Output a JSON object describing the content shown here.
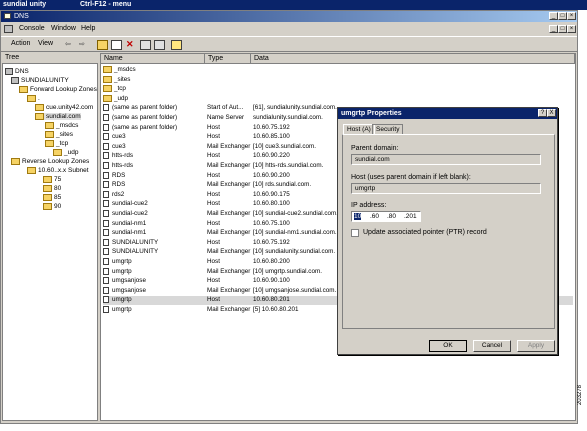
{
  "outer_window": {
    "title_left": "sundial unity",
    "title_right": "Ctrl-F12 - menu"
  },
  "mmc": {
    "title": "DNS",
    "menu": [
      "Console",
      "Window",
      "Help"
    ],
    "action_menu": [
      "Action",
      "View"
    ]
  },
  "tree": {
    "tab_label": "Tree",
    "nodes": [
      {
        "label": "DNS",
        "depth": 0
      },
      {
        "label": "SUNDIALUNITY",
        "depth": 1
      },
      {
        "label": "Forward Lookup Zones",
        "depth": 2
      },
      {
        "label": ".",
        "depth": 3
      },
      {
        "label": "cue.unity42.com",
        "depth": 3
      },
      {
        "label": "sundial.com",
        "depth": 3
      },
      {
        "label": "_msdcs",
        "depth": 4
      },
      {
        "label": "_sites",
        "depth": 4
      },
      {
        "label": "_tcp",
        "depth": 4
      },
      {
        "label": "_udp",
        "depth": 4
      },
      {
        "label": "Reverse Lookup Zones",
        "depth": 2
      },
      {
        "label": "10.60..x.x Subnet",
        "depth": 3
      },
      {
        "label": "75",
        "depth": 4
      },
      {
        "label": "80",
        "depth": 4
      },
      {
        "label": "85",
        "depth": 4
      },
      {
        "label": "90",
        "depth": 4
      }
    ]
  },
  "list": {
    "columns": [
      "Name",
      "Type",
      "Data"
    ],
    "rows": [
      {
        "name": "_msdcs",
        "type": "",
        "data": "",
        "kind": "folder"
      },
      {
        "name": "_sites",
        "type": "",
        "data": "",
        "kind": "folder"
      },
      {
        "name": "_tcp",
        "type": "",
        "data": "",
        "kind": "folder"
      },
      {
        "name": "_udp",
        "type": "",
        "data": "",
        "kind": "folder"
      },
      {
        "name": "(same as parent folder)",
        "type": "Start of Aut...",
        "data": "[61], sundialunity.sundial.com.",
        "kind": "rec"
      },
      {
        "name": "(same as parent folder)",
        "type": "Name Server",
        "data": "sundialunity.sundial.com.",
        "kind": "rec"
      },
      {
        "name": "(same as parent folder)",
        "type": "Host",
        "data": "10.60.75.192",
        "kind": "rec"
      },
      {
        "name": "cue3",
        "type": "Host",
        "data": "10.60.85.100",
        "kind": "rec"
      },
      {
        "name": "cue3",
        "type": "Mail Exchanger",
        "data": "[10] cue3.sundial.com.",
        "kind": "rec"
      },
      {
        "name": "htts-rds",
        "type": "Host",
        "data": "10.60.90.220",
        "kind": "rec"
      },
      {
        "name": "htts-rds",
        "type": "Mail Exchanger",
        "data": "[10] htts-rds.sundial.com.",
        "kind": "rec"
      },
      {
        "name": "RDS",
        "type": "Host",
        "data": "10.60.90.200",
        "kind": "rec"
      },
      {
        "name": "RDS",
        "type": "Mail Exchanger",
        "data": "[10] rds.sundial.com.",
        "kind": "rec"
      },
      {
        "name": "rds2",
        "type": "Host",
        "data": "10.60.90.175",
        "kind": "rec"
      },
      {
        "name": "sundial-cue2",
        "type": "Host",
        "data": "10.60.80.100",
        "kind": "rec"
      },
      {
        "name": "sundial-cue2",
        "type": "Mail Exchanger",
        "data": "[10] sundial-cue2.sundial.com.",
        "kind": "rec"
      },
      {
        "name": "sundial-nm1",
        "type": "Host",
        "data": "10.60.75.100",
        "kind": "rec"
      },
      {
        "name": "sundial-nm1",
        "type": "Mail Exchanger",
        "data": "[10] sundial-nm1.sundial.com.",
        "kind": "rec"
      },
      {
        "name": "SUNDIALUNITY",
        "type": "Host",
        "data": "10.60.75.192",
        "kind": "rec"
      },
      {
        "name": "SUNDIALUNITY",
        "type": "Mail Exchanger",
        "data": "[10] sundialunity.sundial.com.",
        "kind": "rec"
      },
      {
        "name": "umgrtp",
        "type": "Host",
        "data": "10.60.80.200",
        "kind": "rec"
      },
      {
        "name": "umgrtp",
        "type": "Mail Exchanger",
        "data": "[10] umgrtp.sundial.com.",
        "kind": "rec"
      },
      {
        "name": "umgsanjose",
        "type": "Host",
        "data": "10.60.90.100",
        "kind": "rec"
      },
      {
        "name": "umgsanjose",
        "type": "Mail Exchanger",
        "data": "[10] umgsanjose.sundial.com.",
        "kind": "rec"
      },
      {
        "name": "umgrtp",
        "type": "Host",
        "data": "10.60.80.201",
        "kind": "rec",
        "selected": true
      },
      {
        "name": "umgrtp",
        "type": "Mail Exchanger",
        "data": "[5] 10.60.80.201",
        "kind": "rec"
      }
    ]
  },
  "dialog": {
    "title": "umgrtp Properties",
    "help_btn": "?",
    "close_btn": "X",
    "tabs": [
      "Host (A)",
      "Security"
    ],
    "parent_domain_label": "Parent domain:",
    "parent_domain_value": "sundial.com",
    "host_label": "Host (uses parent domain if left blank):",
    "host_value": "umgrtp",
    "ip_label": "IP address:",
    "ip_octets": [
      "10",
      ".60",
      ".80",
      ".201"
    ],
    "ptr_label": "Update associated pointer (PTR) record",
    "ok": "OK",
    "cancel": "Cancel",
    "apply": "Apply"
  },
  "side_label": "203278"
}
